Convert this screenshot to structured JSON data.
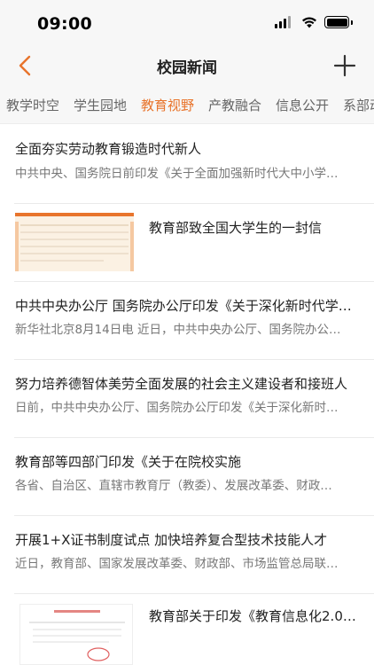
{
  "status_bar": {
    "time": "09:00"
  },
  "nav": {
    "title": "校园新闻",
    "back_icon": "chevron-left-icon",
    "add_icon": "plus-icon"
  },
  "colors": {
    "accent": "#e8742c",
    "background": "#f7f7f7"
  },
  "tabs": [
    {
      "label": "教学时空",
      "active": false
    },
    {
      "label": "学生园地",
      "active": false
    },
    {
      "label": "教育视野",
      "active": true
    },
    {
      "label": "产教融合",
      "active": false
    },
    {
      "label": "信息公开",
      "active": false
    },
    {
      "label": "系部动",
      "active": false
    }
  ],
  "news": [
    {
      "title": "全面夯实劳动教育锻造时代新人",
      "summary": "中共中央、国务院日前印发《关于全面加强新时代大中小学…"
    },
    {
      "title": "教育部致全国大学生的一封信",
      "has_thumbnail": true
    },
    {
      "title": "中共中央办公厅 国务院办公厅印发《关于深化新时代学…",
      "summary": "新华社北京8月14日电 近日，中共中央办公厅、国务院办公…"
    },
    {
      "title": "努力培养德智体美劳全面发展的社会主义建设者和接班人",
      "summary": "日前，中共中央办公厅、国务院办公厅印发《关于深化新时…"
    },
    {
      "title": "教育部等四部门印发《关于在院校实施",
      "summary": "各省、自治区、直辖市教育厅（教委）、发展改革委、财政…"
    },
    {
      "title": "开展1+X证书制度试点 加快培养复合型技术技能人才",
      "summary": "近日，教育部、国家发展改革委、财政部、市场监管总局联…"
    },
    {
      "title": "教育部关于印发《教育信息化2.0…",
      "has_thumbnail": true
    }
  ]
}
